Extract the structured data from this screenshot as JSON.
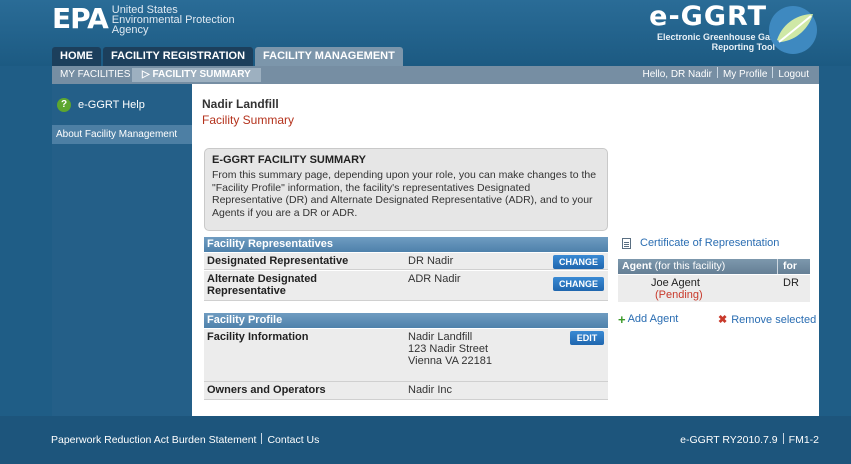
{
  "header": {
    "epa_mark": "EPA",
    "epa_line1": "United States",
    "epa_line2": "Environmental Protection",
    "epa_line3": "Agency",
    "egg_title": "e-GGRT",
    "egg_sub1": "Electronic Greenhouse Gas",
    "egg_sub2": "Reporting Tool"
  },
  "tabs": [
    {
      "label": "HOME"
    },
    {
      "label": "FACILITY REGISTRATION"
    },
    {
      "label": "FACILITY MANAGEMENT"
    }
  ],
  "subnav": {
    "my_facilities": "MY FACILITIES",
    "facility_summary": "FACILITY SUMMARY",
    "greeting": "Hello, DR Nadir",
    "my_profile": "My Profile",
    "logout": "Logout"
  },
  "sidebar": {
    "help": "e-GGRT Help",
    "help_icon": "?",
    "items": [
      {
        "label": "About Facility Management"
      }
    ]
  },
  "main": {
    "facility_name": "Nadir Landfill",
    "page_subtitle": "Facility Summary",
    "summary_title": "E-GGRT FACILITY SUMMARY",
    "summary_text": "From this summary page, depending upon your role, you can make changes to the \"Facility Profile\" information, the facility's representatives Designated Representative (DR) and Alternate Designated Representative (ADR), and to your Agents if you are a DR or ADR.",
    "reps_header": "Facility Representatives",
    "dr_label": "Designated Representative",
    "dr_value": "DR Nadir",
    "adr_label_line1": "Alternate Designated",
    "adr_label_line2": "Representative",
    "adr_value": "ADR Nadir",
    "change_label": "CHANGE",
    "profile_header": "Facility Profile",
    "info_label": "Facility Information",
    "info_line1": "Nadir Landfill",
    "info_line2": "123 Nadir Street",
    "info_line3": "Vienna VA 22181",
    "edit_label": "EDIT",
    "owners_label": "Owners and Operators",
    "owners_value": "Nadir Inc"
  },
  "agents": {
    "certificate_link": "Certificate of Representation",
    "col_agent": "Agent",
    "col_agent_note": "(for this facility)",
    "col_for": "for",
    "rows": [
      {
        "name": "Joe Agent",
        "status": "(Pending)",
        "role": "DR"
      }
    ],
    "add_agent": "Add Agent",
    "remove_selected": "Remove selected"
  },
  "footer": {
    "paperwork": "Paperwork Reduction Act Burden Statement",
    "contact": "Contact Us",
    "version": "e-GGRT RY2010.7.9",
    "page_code": "FM1-2"
  }
}
